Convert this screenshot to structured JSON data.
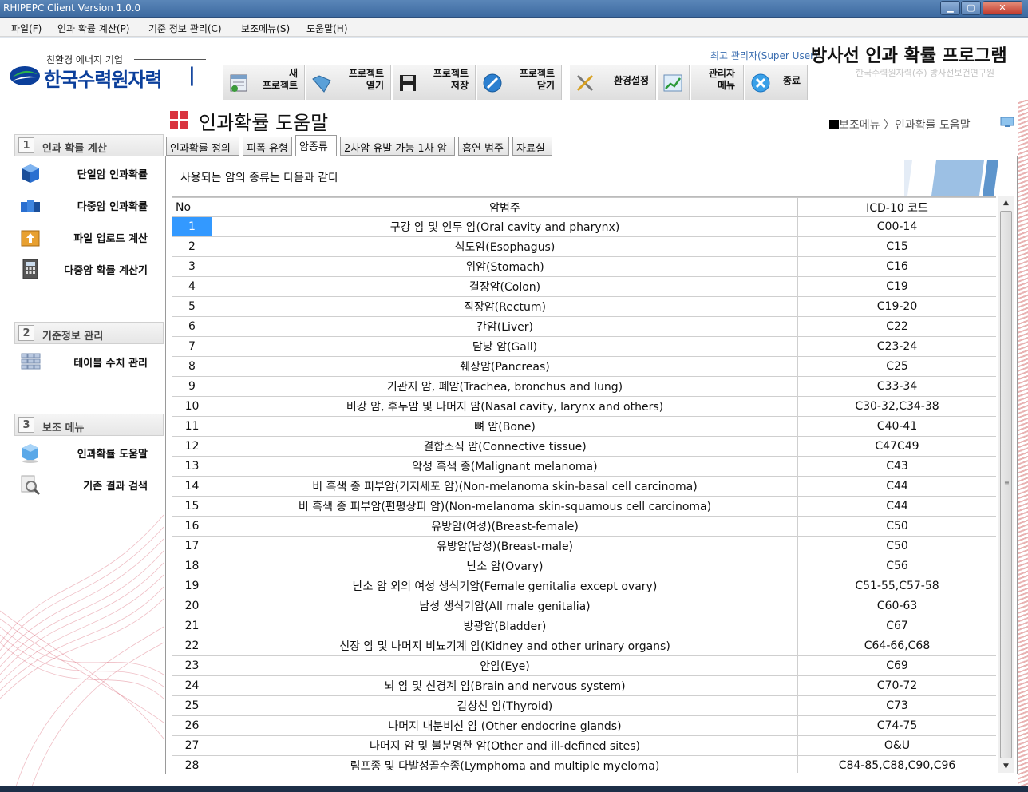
{
  "window": {
    "title": "RHIPEPC Client Version 1.0.0"
  },
  "menu": [
    "파일(F)",
    "인과 확률 계산(P)",
    "기준 정보 관리(C)",
    "보조메뉴(S)",
    "도움말(H)"
  ],
  "header": {
    "logo_sub": "친환경 에너지 기업",
    "logo_text": "한국수력원자력",
    "user_text": "최고 관리자(Super User)",
    "app_title": "방사선 인과 확률 프로그램",
    "app_sub": "한국수력원자력(주) 방사선보건연구원"
  },
  "toolbar": [
    {
      "label": "새\n프로젝트",
      "icon": "new-project-icon"
    },
    {
      "label": "프로젝트\n열기",
      "icon": "open-folder-icon"
    },
    {
      "label": "프로젝트\n저장",
      "icon": "save-disk-icon"
    },
    {
      "label": "프로젝트\n닫기",
      "icon": "close-circle-icon"
    },
    {
      "label": "환경설정",
      "icon": "settings-tools-icon"
    },
    {
      "label": "",
      "icon": "chart-icon"
    },
    {
      "label": "관리자\n메뉴",
      "icon": "admin-icon"
    },
    {
      "label": "종료",
      "icon": "exit-icon"
    }
  ],
  "sidebar": {
    "sections": [
      {
        "num": "1",
        "title": "인과 확률 계산",
        "items": [
          {
            "label": "단일암 인과확률",
            "icon": "cube-icon"
          },
          {
            "label": "다중암 인과확률",
            "icon": "multi-cube-icon"
          },
          {
            "label": "파일 업로드 계산",
            "icon": "upload-box-icon"
          },
          {
            "label": "다중암 확률 계산기",
            "icon": "calculator-icon"
          }
        ]
      },
      {
        "num": "2",
        "title": "기준정보 관리",
        "items": [
          {
            "label": "테이블 수치 관리",
            "icon": "table-icon"
          }
        ]
      },
      {
        "num": "3",
        "title": "보조 메뉴",
        "items": [
          {
            "label": "인과확률 도움말",
            "icon": "help-cube-icon"
          },
          {
            "label": "기존 결과 검색",
            "icon": "search-icon"
          }
        ]
      }
    ]
  },
  "page": {
    "title": "인과확률 도움말",
    "breadcrumb": "보조메뉴 〉인과확률 도움말",
    "tabs": [
      "인과확률 정의",
      "피폭 유형",
      "암종류",
      "2차암 유발 가능 1차 암",
      "흡연 범주",
      "자료실"
    ],
    "active_tab": 2,
    "intro": "사용되는 암의 종류는 다음과 같다"
  },
  "table": {
    "columns": [
      "No",
      "암범주",
      "ICD-10 코드"
    ],
    "selected_row": 0,
    "rows": [
      [
        "1",
        "구강 암 및 인두 암(Oral cavity and pharynx)",
        "C00-14"
      ],
      [
        "2",
        "식도암(Esophagus)",
        "C15"
      ],
      [
        "3",
        "위암(Stomach)",
        "C16"
      ],
      [
        "4",
        "결장암(Colon)",
        "C19"
      ],
      [
        "5",
        "직장암(Rectum)",
        "C19-20"
      ],
      [
        "6",
        "간암(Liver)",
        "C22"
      ],
      [
        "7",
        "담낭 암(Gall)",
        "C23-24"
      ],
      [
        "8",
        "췌장암(Pancreas)",
        "C25"
      ],
      [
        "9",
        "기관지 암, 폐암(Trachea, bronchus and lung)",
        "C33-34"
      ],
      [
        "10",
        "비강 암, 후두암 및 나머지 암(Nasal cavity, larynx and others)",
        "C30-32,C34-38"
      ],
      [
        "11",
        "뼈 암(Bone)",
        "C40-41"
      ],
      [
        "12",
        "결합조직 암(Connective tissue)",
        "C47C49"
      ],
      [
        "13",
        "악성 흑색 종(Malignant melanoma)",
        "C43"
      ],
      [
        "14",
        "비 흑색 종 피부암(기저세포 암)(Non-melanoma skin-basal cell carcinoma)",
        "C44"
      ],
      [
        "15",
        "비 흑색 종 피부암(편평상피 암)(Non-melanoma skin-squamous cell carcinoma)",
        "C44"
      ],
      [
        "16",
        "유방암(여성)(Breast-female)",
        "C50"
      ],
      [
        "17",
        "유방암(남성)(Breast-male)",
        "C50"
      ],
      [
        "18",
        "난소 암(Ovary)",
        "C56"
      ],
      [
        "19",
        "난소 암 외의 여성 생식기암(Female genitalia except ovary)",
        "C51-55,C57-58"
      ],
      [
        "20",
        "남성 생식기암(All male genitalia)",
        "C60-63"
      ],
      [
        "21",
        "방광암(Bladder)",
        "C67"
      ],
      [
        "22",
        "신장 암 및 나머지 비뇨기계 암(Kidney and other urinary organs)",
        "C64-66,C68"
      ],
      [
        "23",
        "안암(Eye)",
        "C69"
      ],
      [
        "24",
        "뇌 암 및 신경계 암(Brain and nervous system)",
        "C70-72"
      ],
      [
        "25",
        "갑상선 암(Thyroid)",
        "C73"
      ],
      [
        "26",
        "나머지 내분비선 암  (Other endocrine glands)",
        "C74-75"
      ],
      [
        "27",
        "나머지 암 및 불분명한 암(Other and ill-defined sites)",
        "O&U"
      ],
      [
        "28",
        "림프종 및 다발성골수종(Lymphoma and multiple myeloma)",
        "C84-85,C88,C90,C96"
      ]
    ]
  },
  "colors": {
    "selection": "#3399ff",
    "title_square": "#d9343f",
    "logo_blue": "#0b3f9b"
  }
}
